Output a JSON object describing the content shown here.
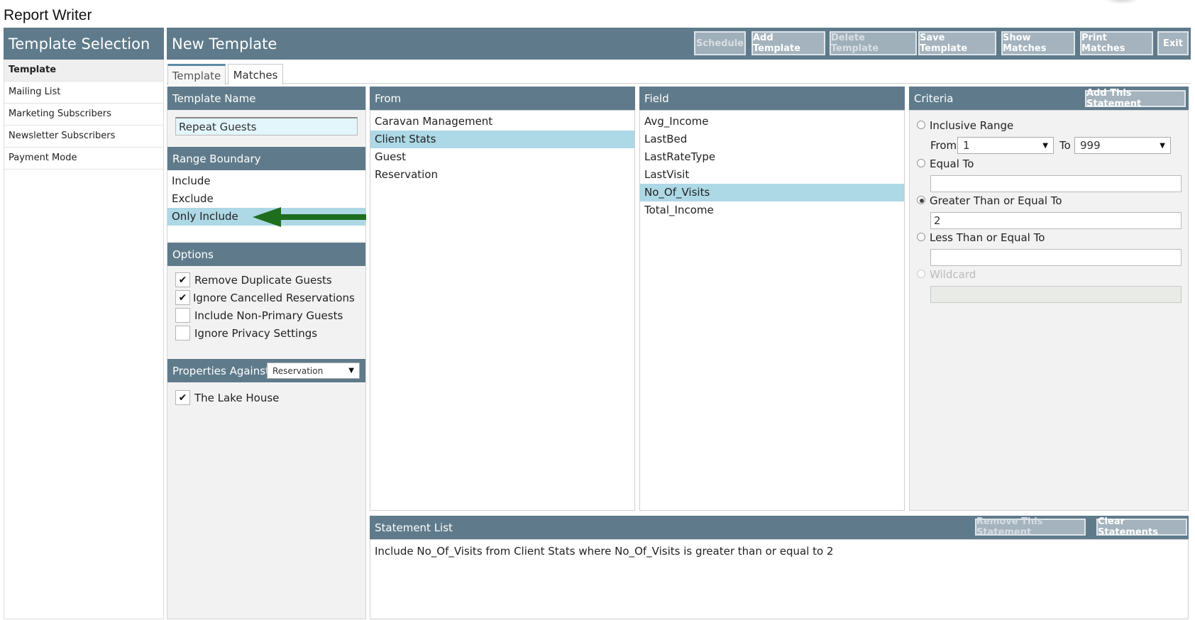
{
  "app": {
    "title": "Report Writer"
  },
  "sidebar": {
    "title": "Template Selection",
    "items": [
      {
        "label": "Template"
      },
      {
        "label": "Mailing List"
      },
      {
        "label": "Marketing Subscribers"
      },
      {
        "label": "Newsletter Subscribers"
      },
      {
        "label": "Payment Mode"
      }
    ]
  },
  "header": {
    "title": "New Template",
    "buttons": {
      "schedule": "Schedule",
      "add_template": "Add Template",
      "delete_template": "Delete Template",
      "save_template": "Save Template",
      "show_matches": "Show Matches",
      "print_matches": "Print Matches",
      "exit": "Exit"
    }
  },
  "tabs": {
    "template": "Template",
    "matches": "Matches"
  },
  "template_name": {
    "heading": "Template Name",
    "value": "Repeat Guests"
  },
  "range_boundary": {
    "heading": "Range Boundary",
    "items": [
      "Include",
      "Exclude",
      "Only Include"
    ],
    "selected": "Only Include"
  },
  "options": {
    "heading": "Options",
    "items": [
      {
        "label": "Remove Duplicate Guests",
        "checked": true
      },
      {
        "label": "Ignore Cancelled Reservations",
        "checked": true
      },
      {
        "label": "Include Non-Primary Guests",
        "checked": false
      },
      {
        "label": "Ignore Privacy Settings",
        "checked": false
      }
    ]
  },
  "properties": {
    "heading": "Properties Against",
    "select_value": "Reservation",
    "items": [
      {
        "label": "The Lake House",
        "checked": true
      }
    ]
  },
  "from": {
    "heading": "From",
    "items": [
      "Caravan Management",
      "Client Stats",
      "Guest",
      "Reservation"
    ],
    "selected": "Client Stats"
  },
  "field": {
    "heading": "Field",
    "items": [
      "Avg_Income",
      "LastBed",
      "LastRateType",
      "LastVisit",
      "No_Of_Visits",
      "Total_Income"
    ],
    "selected": "No_Of_Visits"
  },
  "criteria": {
    "heading": "Criteria",
    "add_button": "Add This Statement",
    "inclusive_range": {
      "label": "Inclusive Range",
      "from_label": "From",
      "from_value": "1",
      "to_label": "To",
      "to_value": "999"
    },
    "equal_to": {
      "label": "Equal To",
      "value": ""
    },
    "greater_equal": {
      "label": "Greater Than or Equal To",
      "value": "2",
      "checked": true
    },
    "less_equal": {
      "label": "Less Than or Equal To",
      "value": ""
    },
    "wildcard": {
      "label": "Wildcard",
      "value": "",
      "disabled": true
    }
  },
  "statement_list": {
    "heading": "Statement List",
    "remove_button": "Remove This Statement",
    "clear_button": "Clear Statements",
    "statements": [
      "Include No_Of_Visits from Client Stats where No_Of_Visits is greater than or equal to 2"
    ]
  },
  "colors": {
    "header_bar": "#5f7b8b",
    "selected_row": "#add8e6",
    "arrow": "#1e6e1e"
  },
  "annotation": {
    "icon": "arrow-left-icon"
  }
}
